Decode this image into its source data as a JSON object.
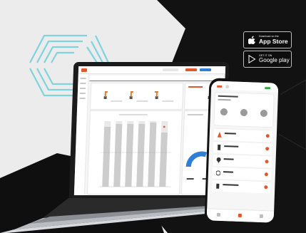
{
  "badges": {
    "appstore": {
      "small": "Download on the",
      "big": "App Store",
      "icon": "apple-icon"
    },
    "googleplay": {
      "small": "GET IT ON",
      "big": "Google play",
      "icon": "play-icon"
    }
  },
  "colors": {
    "accent": "#e4572e",
    "dark_bg": "#111111",
    "light_bg": "#ececec",
    "wireframe": "#7fd3de",
    "gauge_blue": "#2f7fd6"
  }
}
